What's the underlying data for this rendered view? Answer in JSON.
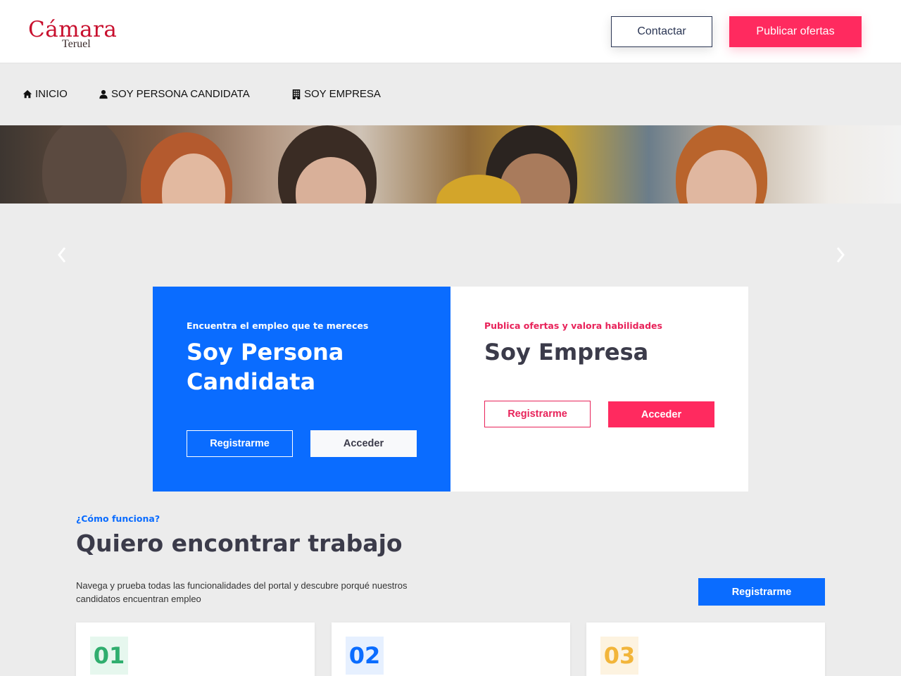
{
  "header": {
    "logo_main": "Cámara",
    "logo_sub": "Teruel",
    "contact_label": "Contactar",
    "publish_label": "Publicar ofertas"
  },
  "nav": {
    "items": [
      {
        "label": "INICIO",
        "icon": "home-icon"
      },
      {
        "label": "SOY PERSONA CANDIDATA",
        "icon": "user-icon"
      },
      {
        "label": "SOY EMPRESA",
        "icon": "building-icon"
      }
    ]
  },
  "candidate_card": {
    "kicker": "Encuentra el empleo que te mereces",
    "title": "Soy Persona Candidata",
    "register_label": "Registrarme",
    "login_label": "Acceder"
  },
  "company_card": {
    "kicker": "Publica ofertas y valora habilidades",
    "title": "Soy Empresa",
    "register_label": "Registrarme",
    "login_label": "Acceder"
  },
  "how": {
    "kicker": "¿Cómo funciona?",
    "title": "Quiero encontrar trabajo",
    "description": "Navega y prueba todas las funcionalidades del portal y descubre porqué nuestros candidatos encuentran empleo",
    "register_label": "Registrarme",
    "steps": [
      {
        "number": "01",
        "color": "#2fae6e",
        "bg": "#e6f7ee"
      },
      {
        "number": "02",
        "color": "#0a6cff",
        "bg": "#e6f0ff"
      },
      {
        "number": "03",
        "color": "#f2b53a",
        "bg": "#fdf3e0"
      }
    ]
  },
  "colors": {
    "brand_red": "#c8102e",
    "accent_pink": "#ff2a5f",
    "accent_blue": "#0a6cff",
    "navy": "#2a3553"
  }
}
